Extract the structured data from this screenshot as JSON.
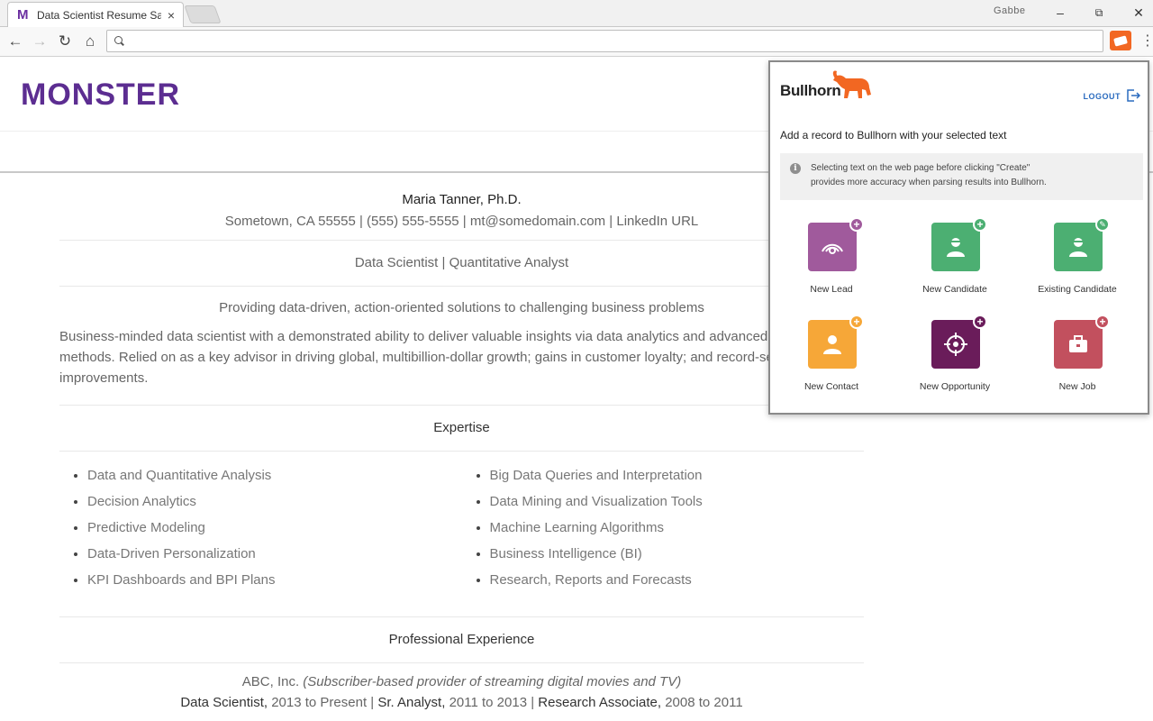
{
  "browser": {
    "tab_title": "Data Scientist Resume Sa",
    "tab_favicon": "M",
    "profile_name": "Gabbe",
    "omnibox_value": "",
    "omnibox_placeholder": "",
    "window_buttons": {
      "minimize": "–",
      "restore": "⧉",
      "close": "✕"
    }
  },
  "site": {
    "logo": "MONSTER",
    "brand_color": "#5c2d91"
  },
  "resume": {
    "name": "Maria Tanner, Ph.D.",
    "contact": "Sometown, CA 55555 | (555) 555-5555 | mt@somedomain.com | LinkedIn URL",
    "headline": "Data Scientist | Quantitative Analyst",
    "tagline": "Providing data-driven, action-oriented solutions to challenging business problems",
    "summary": "Business-minded data scientist with a demonstrated ability to deliver valuable insights via data analytics and advanced data-driven methods. Relied on as a key advisor in driving global, multibillion-dollar growth; gains in customer loyalty; and record-setting profit improvements.",
    "expertise_title": "Expertise",
    "expertise_left": [
      "Data and Quantitative Analysis",
      "Decision Analytics",
      "Predictive Modeling",
      "Data-Driven Personalization",
      "KPI Dashboards and BPI Plans"
    ],
    "expertise_right": [
      "Big Data Queries and Interpretation",
      "Data Mining and Visualization Tools",
      "Machine Learning Algorithms",
      "Business Intelligence (BI)",
      "Research, Reports and Forecasts"
    ],
    "experience_title": "Professional Experience",
    "employer_name": "ABC, Inc.",
    "employer_desc": "(Subscriber-based provider of streaming digital movies and TV)",
    "roles": [
      {
        "title": "Data Scientist,",
        "dates": " 2013 to Present | "
      },
      {
        "title": "Sr. Analyst,",
        "dates": " 2011 to 2013 | "
      },
      {
        "title": "Research Associate,",
        "dates": " 2008 to 2011"
      }
    ]
  },
  "bullhorn": {
    "logo_text": "Bullhorn",
    "logout_label": "LOGOUT",
    "heading": "Add a record to Bullhorn with your selected text",
    "info_line1": "Selecting text on the web page before clicking \"Create\"",
    "info_line2": "provides more accuracy when parsing results into Bullhorn.",
    "accent_color": "#f26722",
    "tiles": [
      {
        "label": "New Lead",
        "color": "#a05a9c",
        "badge": "+",
        "badge_color": "#a05a9c",
        "icon": "lead-icon"
      },
      {
        "label": "New Candidate",
        "color": "#4caf72",
        "badge": "+",
        "badge_color": "#4caf72",
        "icon": "candidate-icon"
      },
      {
        "label": "Existing Candidate",
        "color": "#4caf72",
        "badge": "✎",
        "badge_color": "#4caf72",
        "icon": "existing-candidate-icon"
      },
      {
        "label": "New Contact",
        "color": "#f6a738",
        "badge": "+",
        "badge_color": "#f6a738",
        "icon": "contact-icon"
      },
      {
        "label": "New Opportunity",
        "color": "#6a1c5a",
        "badge": "+",
        "badge_color": "#6a1c5a",
        "icon": "opportunity-icon"
      },
      {
        "label": "New Job",
        "color": "#c2505e",
        "badge": "+",
        "badge_color": "#c2505e",
        "icon": "job-icon"
      }
    ]
  }
}
